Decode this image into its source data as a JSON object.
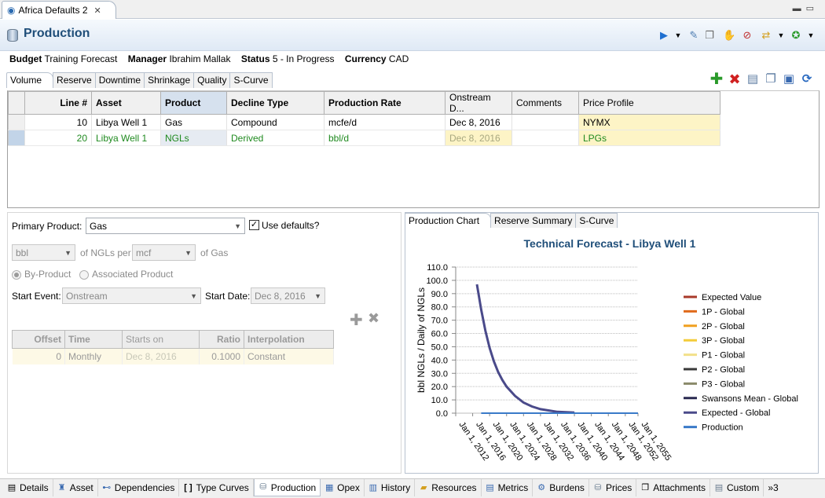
{
  "editor_tab": {
    "title": "Africa Defaults 2",
    "close": "✕"
  },
  "header": {
    "title": "Production"
  },
  "info": {
    "budget_label": "Budget",
    "budget": "Training Forecast",
    "manager_label": "Manager",
    "manager": "Ibrahim Mallak",
    "status_label": "Status",
    "status": "5 - In Progress",
    "currency_label": "Currency",
    "currency": "CAD"
  },
  "subtabs": [
    "Volume",
    "Reserve",
    "Downtime",
    "Shrinkage",
    "Quality",
    "S-Curve"
  ],
  "grid": {
    "columns": [
      "Line #",
      "Asset",
      "Product",
      "Decline Type",
      "Production Rate",
      "Onstream D...",
      "Comments",
      "Price Profile"
    ],
    "rows": [
      [
        "10",
        "Libya Well 1",
        "Gas",
        "Compound",
        "mcfe/d",
        "Dec 8, 2016",
        "",
        "NYMX"
      ],
      [
        "20",
        "Libya Well 1",
        "NGLs",
        "Derived",
        "bbl/d",
        "Dec 8, 2016",
        "",
        "LPGs"
      ]
    ]
  },
  "form": {
    "primary_product_label": "Primary Product:",
    "primary_product": "Gas",
    "use_defaults_label": "Use defaults?",
    "unit1": "bbl",
    "ngls_per_label": "of NGLs per",
    "unit2": "mcf",
    "of_gas_label": "of Gas",
    "by_product_label": "By-Product",
    "associated_product_label": "Associated Product",
    "start_event_label": "Start Event:",
    "start_event": "Onstream",
    "start_date_label": "Start Date:",
    "start_date": "Dec 8, 2016"
  },
  "ratio_table": {
    "columns": [
      "Offset",
      "Time",
      "Starts on",
      "Ratio",
      "Interpolation"
    ],
    "rows": [
      [
        "0",
        "Monthly",
        "Dec 8, 2016",
        "0.1000",
        "Constant"
      ]
    ]
  },
  "chart_tabs": [
    "Production Chart",
    "Reserve Summary",
    "S-Curve"
  ],
  "chart_data": {
    "type": "line",
    "title": "Technical Forecast - Libya Well 1",
    "ylabel": "bbl NGLs / Daily of NGLs",
    "xlabel": "",
    "ylim": [
      0,
      110
    ],
    "yticks": [
      "110.0",
      "100.0",
      "90.0",
      "80.0",
      "70.0",
      "60.0",
      "50.0",
      "40.0",
      "30.0",
      "20.0",
      "10.0",
      "0.0"
    ],
    "xticks": [
      "Jan 1, 2012",
      "Jan 1, 2016",
      "Jan 1, 2020",
      "Jan 1, 2024",
      "Jan 1, 2028",
      "Jan 1, 2032",
      "Jan 1, 2036",
      "Jan 1, 2040",
      "Jan 1, 2044",
      "Jan 1, 2048",
      "Jan 1, 2052",
      "Jan 1, 2055"
    ],
    "legend_position": "right",
    "legend": [
      {
        "name": "Expected Value",
        "color": "#a83a2a"
      },
      {
        "name": "1P - Global",
        "color": "#e06a1a"
      },
      {
        "name": "2P - Global",
        "color": "#f0a020"
      },
      {
        "name": "3P - Global",
        "color": "#f4cc3a"
      },
      {
        "name": "P1 - Global",
        "color": "#f2e08a"
      },
      {
        "name": "P2 - Global",
        "color": "#3a3a3a"
      },
      {
        "name": "P3 - Global",
        "color": "#8a8a6a"
      },
      {
        "name": "Swansons Mean - Global",
        "color": "#2a2a50"
      },
      {
        "name": "Expected - Global",
        "color": "#4a4a8a"
      },
      {
        "name": "Production",
        "color": "#3a7ac8"
      }
    ],
    "series": [
      {
        "name": "Expected - Global",
        "color": "#4a4a8a",
        "x": [
          "2017-01",
          "2018-01",
          "2019-01",
          "2020-01",
          "2021-01",
          "2022-01",
          "2023-01",
          "2024-01",
          "2026-01",
          "2028-01",
          "2030-01",
          "2032-01",
          "2034-01",
          "2036-01",
          "2040-01"
        ],
        "values": [
          97,
          78,
          62,
          49,
          39,
          31,
          25,
          20,
          13,
          8,
          5,
          3,
          2,
          1,
          0.5
        ]
      },
      {
        "name": "Production",
        "color": "#3a7ac8",
        "x": [
          "2018-01",
          "2055-01"
        ],
        "values": [
          0,
          0
        ]
      }
    ]
  },
  "bottom_tabs": [
    "Details",
    "Asset",
    "Dependencies",
    "Type Curves",
    "Production",
    "Opex",
    "History",
    "Resources",
    "Metrics",
    "Burdens",
    "Prices",
    "Attachments",
    "Custom"
  ],
  "bottom_overflow": "»3",
  "colors": {
    "accent": "#1f4e79",
    "green_row": "#1f8a1f",
    "highlight": "#fdf4c6"
  }
}
